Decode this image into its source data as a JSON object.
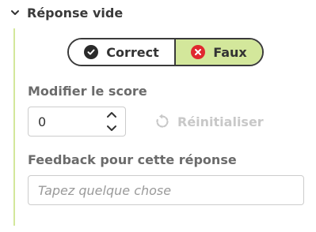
{
  "section": {
    "title": "Réponse vide",
    "expanded": true
  },
  "answer_toggle": {
    "options": [
      {
        "label": "Correct",
        "icon": "check-circle-icon",
        "selected": false
      },
      {
        "label": "Faux",
        "icon": "x-circle-icon",
        "selected": true
      }
    ]
  },
  "score": {
    "label": "Modifier le score",
    "value": "0",
    "reset_label": "Réinitialiser"
  },
  "feedback": {
    "label": "Feedback pour cette réponse",
    "placeholder": "Tapez quelque chose",
    "value": ""
  },
  "colors": {
    "accent": "#d3e79b",
    "error_icon": "#e0282f",
    "disabled_text": "#c8c8c8"
  }
}
